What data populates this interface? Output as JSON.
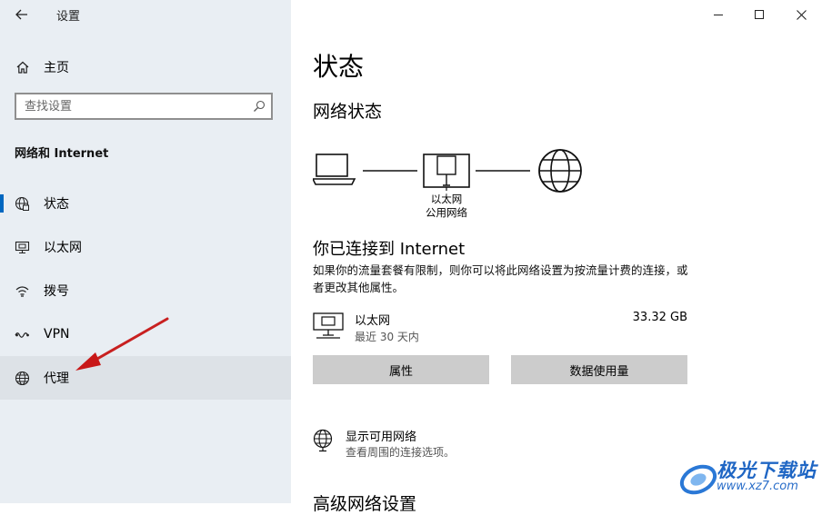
{
  "window": {
    "title": "设置"
  },
  "sidebar": {
    "home_label": "主页",
    "search_placeholder": "查找设置",
    "section_title": "网络和 Internet",
    "items": [
      {
        "label": "状态",
        "icon": "globe-ethernet-icon",
        "selected": true
      },
      {
        "label": "以太网",
        "icon": "ethernet-icon"
      },
      {
        "label": "拨号",
        "icon": "dialup-icon"
      },
      {
        "label": "VPN",
        "icon": "vpn-icon"
      },
      {
        "label": "代理",
        "icon": "globe-icon",
        "hovered": true
      }
    ]
  },
  "main": {
    "title": "状态",
    "network_status_heading": "网络状态",
    "device_label_line1": "以太网",
    "device_label_line2": "公用网络",
    "connected_text": "你已连接到 Internet",
    "description": "如果你的流量套餐有限制，则你可以将此网络设置为按流量计费的连接，或者更改其他属性。",
    "connection": {
      "name": "以太网",
      "period": "最近 30 天内",
      "usage": "33.32 GB"
    },
    "buttons": {
      "properties": "属性",
      "data_usage": "数据使用量"
    },
    "available_networks": {
      "title": "显示可用网络",
      "subtitle": "查看周围的连接选项。"
    },
    "advanced_heading": "高级网络设置"
  },
  "watermark": {
    "text": "极光下载站",
    "url": "www.xz7.com"
  },
  "colors": {
    "sidebar_bg": "#e9eef3",
    "accent": "#0067c0",
    "button_bg": "#cccccc",
    "arrow": "#d42020"
  }
}
